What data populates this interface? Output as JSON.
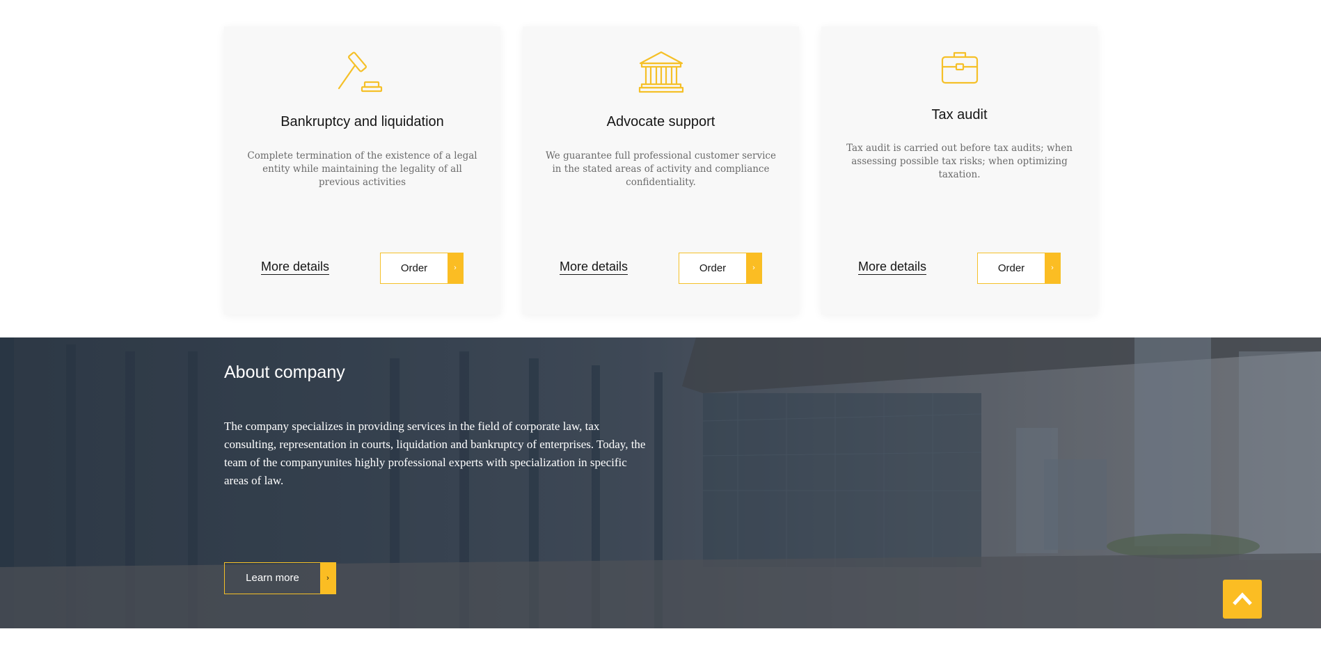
{
  "services": [
    {
      "icon": "gavel-icon",
      "title": "Bankruptcy and liquidation",
      "description": "Complete termination of the existence of a legal entity while maintaining the legality of all previous activities",
      "more_label": "More details",
      "order_label": "Order"
    },
    {
      "icon": "courthouse-icon",
      "title": "Advocate support",
      "description": "We guarantee full professional customer service in the stated areas of activity and compliance confidentiality.",
      "more_label": "More details",
      "order_label": "Order"
    },
    {
      "icon": "briefcase-icon",
      "title": "Tax audit",
      "description": "Tax audit is carried out before tax audits; when assessing possible tax risks; when optimizing taxation.",
      "more_label": "More details",
      "order_label": "Order"
    }
  ],
  "about": {
    "title": "About company",
    "text": "The company specializes in providing services in the field of corporate law, tax consulting, representation in courts, liquidation and bankruptcy of enterprises. Today, the team of the companyunites highly professional experts with specialization in specific areas of law.",
    "button_label": "Learn more"
  },
  "scroll_top": {
    "icon": "chevron-up-icon"
  },
  "colors": {
    "accent": "#fbbd23",
    "card_bg": "#f8f8f8",
    "text_dark": "#151515",
    "text_muted": "#6a6a6a"
  }
}
